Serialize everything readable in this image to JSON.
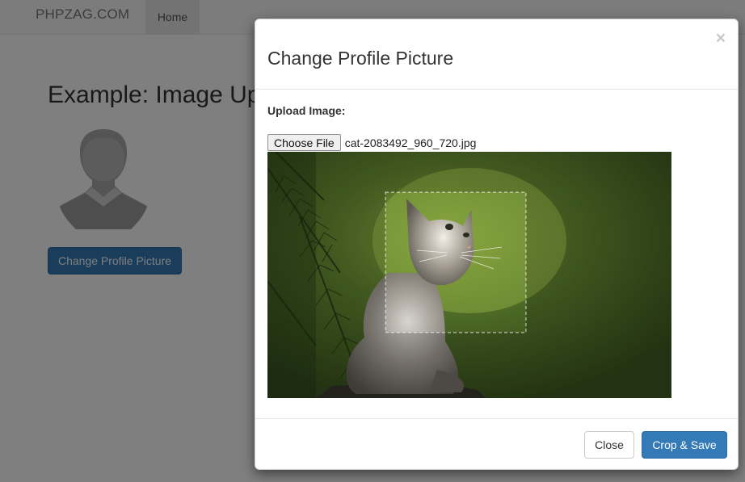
{
  "navbar": {
    "brand": "PHPZAG.COM",
    "home_label": "Home"
  },
  "page": {
    "heading": "Example: Image Up",
    "change_button_label": "Change Profile Picture"
  },
  "modal": {
    "title": "Change Profile Picture",
    "close_symbol": "×",
    "upload_label": "Upload Image:",
    "choose_file_label": "Choose File",
    "file_name": "cat-2083492_960_720.jpg",
    "close_button_label": "Close",
    "crop_save_button_label": "Crop & Save"
  },
  "colors": {
    "primary": "#337ab7",
    "primary_border": "#2e6da4",
    "backdrop": "rgba(0,0,0,0.5)"
  },
  "icons": {
    "avatar": "user-silhouette-icon",
    "close": "close-icon"
  }
}
